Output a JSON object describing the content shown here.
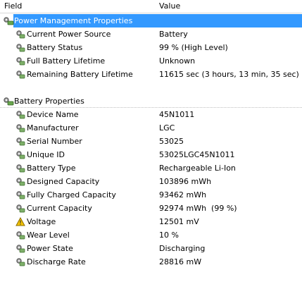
{
  "header": {
    "field": "Field",
    "value": "Value"
  },
  "sections": [
    {
      "title": "Power Management Properties",
      "selected": true,
      "rows": [
        {
          "label": "Current Power Source",
          "value": "Battery",
          "icon": "battery-gear-icon"
        },
        {
          "label": "Battery Status",
          "value": "99 % (High Level)",
          "icon": "battery-gear-icon"
        },
        {
          "label": "Full Battery Lifetime",
          "value": "Unknown",
          "icon": "battery-gear-icon"
        },
        {
          "label": "Remaining Battery Lifetime",
          "value": "11615 sec (3 hours, 13 min, 35 sec)",
          "icon": "battery-gear-icon"
        }
      ]
    },
    {
      "title": "Battery Properties",
      "selected": false,
      "rows": [
        {
          "label": "Device Name",
          "value": "45N1011",
          "icon": "battery-gear-icon"
        },
        {
          "label": "Manufacturer",
          "value": "LGC",
          "icon": "battery-gear-icon"
        },
        {
          "label": "Serial Number",
          "value": "53025",
          "icon": "battery-gear-icon"
        },
        {
          "label": "Unique ID",
          "value": "53025LGC45N1011",
          "icon": "battery-gear-icon"
        },
        {
          "label": "Battery Type",
          "value": "Rechargeable Li-Ion",
          "icon": "battery-gear-icon"
        },
        {
          "label": "Designed Capacity",
          "value": "103896 mWh",
          "icon": "battery-gear-icon"
        },
        {
          "label": "Fully Charged Capacity",
          "value": "93462 mWh",
          "icon": "battery-gear-icon"
        },
        {
          "label": "Current Capacity",
          "value": "92974 mWh  (99 %)",
          "icon": "battery-gear-icon"
        },
        {
          "label": "Voltage",
          "value": "12501 mV",
          "icon": "warning-triangle-icon"
        },
        {
          "label": "Wear Level",
          "value": "10 %",
          "icon": "battery-gear-icon"
        },
        {
          "label": "Power State",
          "value": "Discharging",
          "icon": "battery-gear-icon"
        },
        {
          "label": "Discharge Rate",
          "value": "28816 mW",
          "icon": "battery-gear-icon"
        }
      ]
    }
  ],
  "colors": {
    "selection": "#3399ff",
    "warning": "#f5c400"
  }
}
